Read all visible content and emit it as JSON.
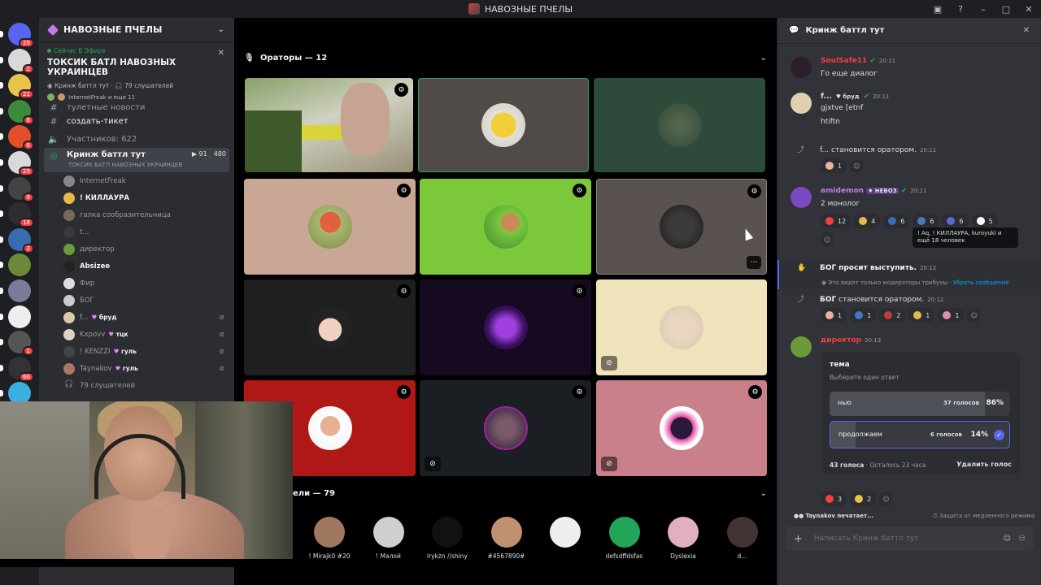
{
  "window": {
    "title": "НАВОЗНЫЕ ПЧЕЛЫ"
  },
  "rail": {
    "servers": [
      {
        "badge": "28",
        "color": "#5865f2"
      },
      {
        "badge": "2",
        "color": "#d9d9d9"
      },
      {
        "badge": "21",
        "color": "#e8c54a"
      },
      {
        "badge": "6",
        "color": "#3c8a3c"
      },
      {
        "badge": "6",
        "color": "#e24f2a"
      },
      {
        "badge": "29",
        "color": "#d9d9d9"
      },
      {
        "badge": "9",
        "color": "#444444"
      },
      {
        "badge": "18",
        "color": "#2e2e2e"
      },
      {
        "badge": "2",
        "color": "#3a6ab0"
      },
      {
        "badge": "",
        "color": "#6a8a3a"
      },
      {
        "badge": "",
        "color": "#7a7a9a"
      },
      {
        "badge": "",
        "color": "#eeeeee"
      },
      {
        "badge": "1",
        "color": "#555555"
      },
      {
        "badge": "66",
        "color": "#333333"
      },
      {
        "badge": "",
        "color": "#3ab0e0"
      }
    ]
  },
  "sidebar": {
    "server_name": "НАВОЗНЫЕ ПЧЕЛЫ",
    "live_label": "Сейчас В Эфире",
    "stage_title": "ТОКСИК БАТЛ НАВОЗНЫХ УКРАИНЦЕВ",
    "stage_meta_channel": "Кринж баттл тут",
    "stage_meta_listeners": "79 слушателей",
    "stage_meta_users": "InternetFreak и еще 11",
    "partial_channel": "тулетные новости",
    "ticket_channel": "создать-тикет",
    "members_channel": "Участников: 622",
    "active_channel": {
      "name": "Кринж баттл тут",
      "sub": "ТОКСИК БАТЛ НАВОЗНЫХ УКРАИНЦЕВ",
      "count_a": "91",
      "count_b": "480"
    },
    "users": [
      {
        "name": "InternetFreak",
        "bold": false,
        "color": "#888888",
        "tag": "",
        "muted": false
      },
      {
        "name": "! КИЛЛАУРА",
        "bold": true,
        "color": "#e8b84a",
        "tag": "",
        "muted": false
      },
      {
        "name": "галка сообразительница",
        "bold": false,
        "color": "#7a6a5a",
        "tag": "",
        "muted": false
      },
      {
        "name": "t...",
        "bold": false,
        "color": "#3a3a3a",
        "tag": "",
        "muted": false
      },
      {
        "name": "директор",
        "bold": false,
        "color": "#6a9a3a",
        "tag": "",
        "muted": false
      },
      {
        "name": "Absizee",
        "bold": true,
        "color": "#222222",
        "tag": "",
        "muted": false
      },
      {
        "name": "Фир",
        "bold": false,
        "color": "#dddddd",
        "tag": "",
        "muted": false
      },
      {
        "name": "БОГ",
        "bold": false,
        "color": "#cccccc",
        "tag": "",
        "muted": false
      },
      {
        "name": "f...",
        "bold": false,
        "color": "#d9c9a9",
        "tag": "брyд",
        "muted": true
      },
      {
        "name": "Kxpovv",
        "bold": false,
        "color": "#e0d0c0",
        "tag": "тцк",
        "muted": true
      },
      {
        "name": "! KENZZI",
        "bold": false,
        "color": "#444444",
        "tag": "гуль",
        "muted": true
      },
      {
        "name": "Taynakov",
        "bold": false,
        "color": "#aa7766",
        "tag": "гуль",
        "muted": true
      }
    ],
    "listeners_label": "79 слушателей"
  },
  "stage": {
    "speakers_header": "Ораторы — 12",
    "audience_header": "ели — 79",
    "audience": [
      {
        "name": "! Mirajk0 #20",
        "color": "#a07860"
      },
      {
        "name": "! Малой",
        "color": "#cfcfcf"
      },
      {
        "name": "lrykzn //shiny",
        "color": "#111111"
      },
      {
        "name": "#4567890#",
        "color": "#c09070"
      },
      {
        "name": "",
        "color": "#eeeeee"
      },
      {
        "name": "defsdffdsfas",
        "color": "#23a559"
      },
      {
        "name": "Dyslexia",
        "color": "#e0b0c0"
      },
      {
        "name": "d...",
        "color": "#443333"
      }
    ]
  },
  "chat": {
    "title": "Кринж баттл тут",
    "messages": [
      {
        "author": "SoulSafe11",
        "author_color": "#f23f43",
        "time": "20:11",
        "text": "Го еще диалог",
        "av_color": "#2a1f2a"
      },
      {
        "author": "f...",
        "author_color": "#dbdee1",
        "role": "брyд",
        "time": "20:11",
        "text": "gjxtve [etnf",
        "text2": "htiftn",
        "av_color": "#e0d0b0"
      },
      {
        "author": "amidemon",
        "author_color": "#c17ae6",
        "role": "НЕВОЗ",
        "time": "20:11",
        "text": "2 монолог",
        "av_color": "#7a4ac0"
      },
      {
        "author": "директор",
        "author_color": "#f23f43",
        "time": "20:13",
        "av_color": "#6a9a3a"
      }
    ],
    "sys1": {
      "user": "f...",
      "text": "становится оратором.",
      "time": "20:11"
    },
    "sys2": {
      "user": "БОГ",
      "text": "просит выступить.",
      "time": "20:12"
    },
    "sys3": {
      "user": "БОГ",
      "text": "становится оратором.",
      "time": "20:12"
    },
    "note_text": "Это видят только модераторы трибуны · ",
    "note_link": "Убрать сообщение",
    "tooltip": "! Aq, ! КИЛЛАУРА, kuroyuki и ещё 18 человек",
    "reacts_a": [
      {
        "c": "1",
        "col": "#f0b0a0"
      }
    ],
    "reacts_b": [
      {
        "c": "12",
        "col": "#f23f43"
      },
      {
        "c": "4",
        "col": "#e8b84a"
      },
      {
        "c": "6",
        "col": "#3a6ab0"
      },
      {
        "c": "6",
        "col": "#4a7ac0"
      },
      {
        "c": "6",
        "col": "#5a6ad0"
      },
      {
        "c": "5",
        "col": "#ffffff"
      }
    ],
    "reacts_c": [
      {
        "c": "1",
        "col": "#f0b0a0"
      },
      {
        "c": "1",
        "col": "#3a7ac0"
      },
      {
        "c": "2",
        "col": "#c03a3a"
      },
      {
        "c": "1",
        "col": "#e8b84a"
      },
      {
        "c": "1",
        "col": "#e090a0"
      }
    ],
    "reacts_d": [
      {
        "c": "3",
        "col": "#f23f43"
      },
      {
        "c": "2",
        "col": "#e8c54a"
      }
    ],
    "poll": {
      "question": "тема",
      "subtitle": "Выберите один ответ",
      "options": [
        {
          "label": "нью",
          "votes": "37 голосов",
          "pct": "86%",
          "fill": 0.86,
          "selected": false
        },
        {
          "label": "продолжаем",
          "votes": "6 голосов",
          "pct": "14%",
          "fill": 0.14,
          "selected": true
        }
      ],
      "total": "43 голоса",
      "remaining": "Осталось 23 часа",
      "remove": "Удалить голос"
    },
    "typing": "Taynakov печатает...",
    "slowmode": "Защита от медленного режима",
    "placeholder": "Написать Кринж баттл тут"
  }
}
